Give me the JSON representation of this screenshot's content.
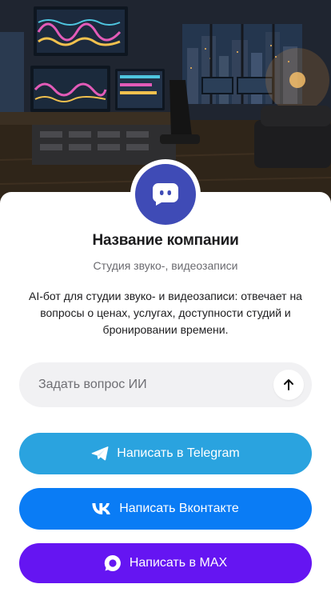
{
  "company": {
    "name": "Название компании",
    "subtitle": "Студия звуко-, видеозаписи",
    "description": "AI-бот для студии звуко- и видеозаписи: отвечает на вопросы о ценах, услугах, доступности студий и бронировании времени."
  },
  "avatar": {
    "icon": "bot-chat-icon",
    "color": "#3f4bb6"
  },
  "hero": {
    "icon": "studio-photo"
  },
  "ask": {
    "placeholder": "Задать вопрос ИИ",
    "value": "",
    "send_icon": "arrow-up-icon"
  },
  "buttons": {
    "telegram": {
      "label": "Написать в Telegram",
      "icon": "telegram-icon",
      "color": "#2aa3df"
    },
    "vk": {
      "label": "Написать Вконтакте",
      "icon": "vk-icon",
      "color": "#0a7cf5"
    },
    "max": {
      "label": "Написать в MAX",
      "icon": "max-icon",
      "color": "#6515f2"
    }
  }
}
